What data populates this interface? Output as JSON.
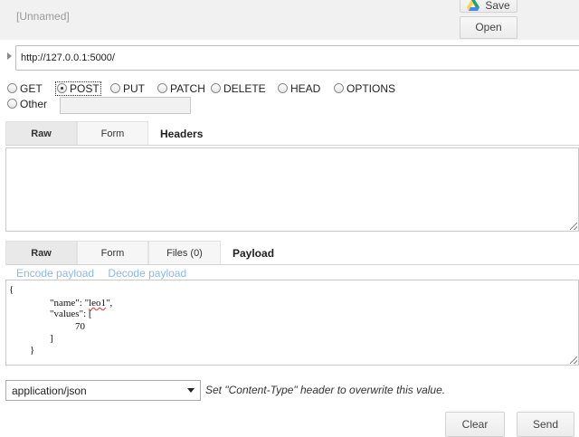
{
  "request": {
    "name": "[Unnamed]",
    "save_label": "Save",
    "open_label": "Open"
  },
  "url": {
    "value": "http://127.0.0.1:5000/"
  },
  "methods": {
    "options": [
      "GET",
      "POST",
      "PUT",
      "PATCH",
      "DELETE",
      "HEAD",
      "OPTIONS"
    ],
    "selected": "POST",
    "other_label": "Other",
    "other_value": ""
  },
  "headers_section": {
    "tabs": [
      "Raw",
      "Form"
    ],
    "active": "Raw",
    "title": "Headers",
    "value": ""
  },
  "payload_section": {
    "tabs": [
      "Raw",
      "Form",
      "Files (0)"
    ],
    "active": "Raw",
    "title": "Payload",
    "encode_link": "Encode payload",
    "decode_link": "Decode payload",
    "body_lines": [
      "{",
      "\"name\": \"leo1\",",
      "\"values\": [",
      "70",
      "]",
      "}"
    ]
  },
  "content_type": {
    "selected": "application/json",
    "hint": "Set \"Content-Type\" header to overwrite this value."
  },
  "actions": {
    "clear_label": "Clear",
    "send_label": "Send"
  },
  "icons": {
    "save": "google-drive-icon",
    "url_toggle": "triangle-right-icon",
    "dropdown": "chevron-down-icon"
  },
  "colors": {
    "link": "#8bb8e8",
    "topbar": "#f1f1f1",
    "active_tab": "#e9e9e9"
  }
}
